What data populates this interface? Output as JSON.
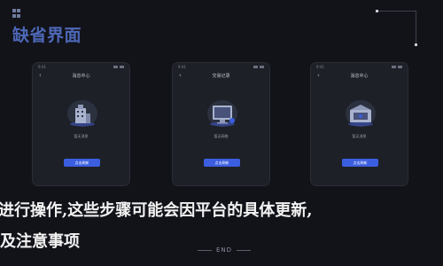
{
  "header": {
    "title": "缺省界面"
  },
  "phones": [
    {
      "status_time": "9:41",
      "nav_title": "消息中心",
      "empty_text": "暂无消息",
      "button_label": "点击刷新"
    },
    {
      "status_time": "9:41",
      "nav_title": "交易记录",
      "empty_text": "暂无网络",
      "button_label": "点击刷新"
    },
    {
      "status_time": "9:41",
      "nav_title": "消息中心",
      "empty_text": "暂无消息",
      "button_label": "点击刷新"
    }
  ],
  "overlay": {
    "line1": "进行操作,这些步骤可能会因平台的具体更新,",
    "line2": "及注意事项"
  },
  "footer": {
    "end_label": "END"
  },
  "colors": {
    "background": "#121319",
    "title": "#4e68b8",
    "button": "#3b5ee0",
    "phone_bg": "#1d2027"
  },
  "icons": {
    "back": "chevron-left-icon",
    "empty_illustration": "empty-state-illustration"
  }
}
